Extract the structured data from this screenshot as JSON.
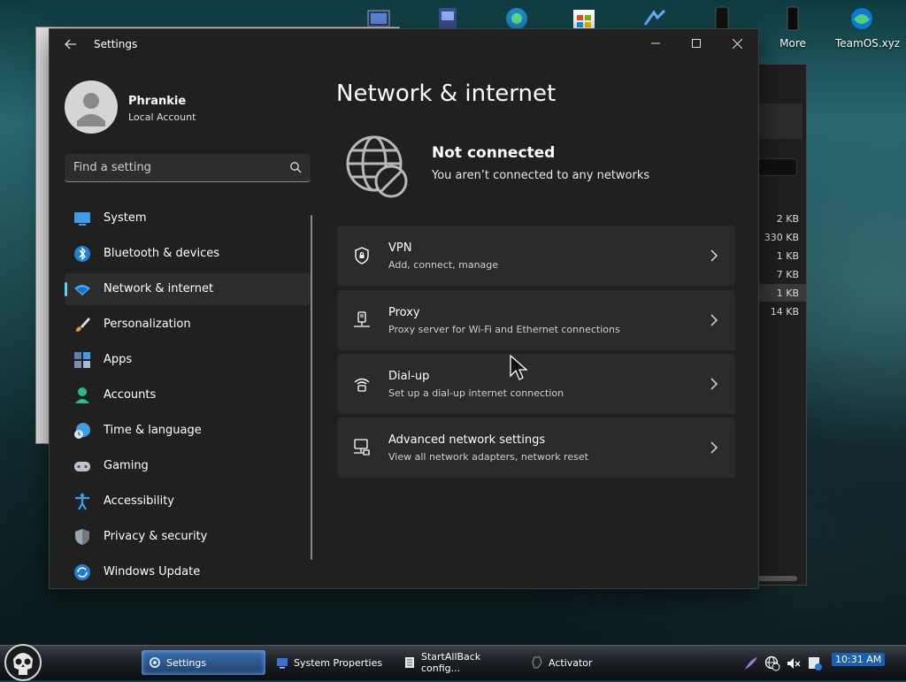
{
  "desktop": {
    "icons": [
      {
        "name": "desktop-icon-1",
        "label": ""
      },
      {
        "name": "desktop-icon-2",
        "label": ""
      },
      {
        "name": "desktop-icon-3",
        "label": ""
      },
      {
        "name": "desktop-icon-4",
        "label": ""
      },
      {
        "name": "desktop-icon-5",
        "label": ""
      },
      {
        "name": "desktop-icon-more",
        "label": "More"
      },
      {
        "name": "desktop-icon-teamos",
        "label": "TeamOS.xyz"
      }
    ]
  },
  "bg_window": {
    "sizes": [
      "2 KB",
      "330 KB",
      "1 KB",
      "7 KB",
      "1 KB",
      "14 KB"
    ]
  },
  "window": {
    "title": "Settings",
    "minimize": "—",
    "maximize": "☐",
    "close": "✕"
  },
  "profile": {
    "name": "Phrankie",
    "account_type": "Local Account"
  },
  "search": {
    "placeholder": "Find a setting"
  },
  "nav": {
    "items": [
      {
        "label": "System",
        "icon": "system-icon"
      },
      {
        "label": "Bluetooth & devices",
        "icon": "bluetooth-icon"
      },
      {
        "label": "Network & internet",
        "icon": "network-icon",
        "active": true
      },
      {
        "label": "Personalization",
        "icon": "brush-icon"
      },
      {
        "label": "Apps",
        "icon": "apps-icon"
      },
      {
        "label": "Accounts",
        "icon": "accounts-icon"
      },
      {
        "label": "Time & language",
        "icon": "time-language-icon"
      },
      {
        "label": "Gaming",
        "icon": "gaming-icon"
      },
      {
        "label": "Accessibility",
        "icon": "accessibility-icon"
      },
      {
        "label": "Privacy & security",
        "icon": "shield-icon"
      },
      {
        "label": "Windows Update",
        "icon": "update-icon"
      }
    ]
  },
  "main": {
    "page_title": "Network & internet",
    "status": {
      "title": "Not connected",
      "subtitle": "You aren’t connected to any networks"
    },
    "cards": [
      {
        "title": "VPN",
        "subtitle": "Add, connect, manage",
        "icon": "vpn-shield-icon"
      },
      {
        "title": "Proxy",
        "subtitle": "Proxy server for Wi-Fi and Ethernet connections",
        "icon": "proxy-icon"
      },
      {
        "title": "Dial-up",
        "subtitle": "Set up a dial-up internet connection",
        "icon": "dialup-icon"
      },
      {
        "title": "Advanced network settings",
        "subtitle": "View all network adapters, network reset",
        "icon": "advanced-network-icon"
      }
    ]
  },
  "taskbar": {
    "buttons": [
      {
        "label": "Settings",
        "icon": "settings-icon",
        "active": true
      },
      {
        "label": "System Properties",
        "icon": "system-properties-icon"
      },
      {
        "label": "StartAllBack config...",
        "icon": "startallback-icon"
      },
      {
        "label": "Activator",
        "icon": "activator-icon"
      }
    ],
    "clock": "10:31 AM"
  },
  "colors": {
    "accent": "#60cdff",
    "window_bg": "#202020",
    "card_bg": "#2b2b2b"
  }
}
